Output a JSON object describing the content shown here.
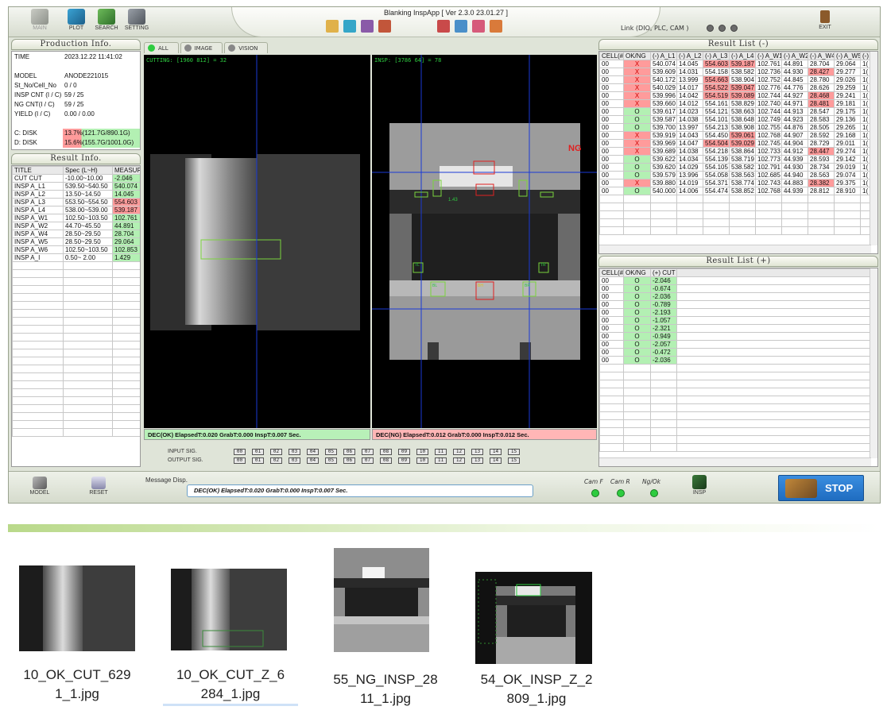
{
  "topbar": {
    "main_label": "MAIN",
    "plot_label": "PLOT",
    "search_label": "SEARCH",
    "setting_label": "SETTING",
    "title": "Blanking InspApp  [ Ver 2.3.0  23.01.27 ]",
    "link_label": "Link (DIO, PLC, CAM )",
    "exit_label": "EXIT"
  },
  "production": {
    "header": "Production Info.",
    "rows": [
      {
        "k": "TIME",
        "v": "2023.12.22  11:41:02"
      },
      {
        "k": "",
        "v": ""
      },
      {
        "k": "MODEL",
        "v": "ANODE221015"
      },
      {
        "k": "St_No/Cell_No",
        "v": "0 / 0"
      },
      {
        "k": "INSP CNT (I / C)",
        "v": "59 / 25"
      },
      {
        "k": "NG CNT(I / C)",
        "v": "59 / 25"
      },
      {
        "k": "YIELD (I / C)",
        "v": "0.00 /  0.00"
      },
      {
        "k": "",
        "v": ""
      },
      {
        "k": "C: DISK",
        "v": "13.7%(121.7G/890.1G)"
      },
      {
        "k": "D: DISK",
        "v": "15.6%(155.7G/1001.0G)"
      }
    ]
  },
  "result_info": {
    "header": "Result Info.",
    "columns": [
      "TITLE",
      "Spec (L~H)",
      "MEASUR"
    ],
    "rows": [
      {
        "title": "CUT CUT",
        "spec": "-10.00~10.00",
        "meas": "-2.046",
        "status": "ok"
      },
      {
        "title": "INSP A_L1",
        "spec": "539.50~540.50",
        "meas": "540.074",
        "status": "ok"
      },
      {
        "title": "INSP A_L2",
        "spec": "13.50~14.50",
        "meas": "14.045",
        "status": "ok"
      },
      {
        "title": "INSP A_L3",
        "spec": "553.50~554.50",
        "meas": "554.603",
        "status": "ng"
      },
      {
        "title": "INSP A_L4",
        "spec": "538.00~539.00",
        "meas": "539.187",
        "status": "ng"
      },
      {
        "title": "INSP A_W1",
        "spec": "102.50~103.50",
        "meas": "102.761",
        "status": "ok"
      },
      {
        "title": "INSP A_W2",
        "spec": "44.70~45.50",
        "meas": "44.891",
        "status": "ok"
      },
      {
        "title": "INSP A_W4",
        "spec": "28.50~29.50",
        "meas": "28.704",
        "status": "ok"
      },
      {
        "title": "INSP A_W5",
        "spec": "28.50~29.50",
        "meas": "29.064",
        "status": "ok"
      },
      {
        "title": "INSP A_W6",
        "spec": "102.50~103.50",
        "meas": "102.853",
        "status": "ok"
      },
      {
        "title": "INSP A_I",
        "spec": "0.50~ 2.00",
        "meas": "1.429",
        "status": "ok"
      }
    ]
  },
  "view_tabs": [
    "ALL",
    "IMAGE",
    "VISION"
  ],
  "cam_left": {
    "label": "CUTTING:  [1960  812] = 32",
    "status": "DEC(OK)  ElapsedT:0.020  GrabT:0.000 InspT:0.007 Sec."
  },
  "cam_right": {
    "label": "INSP:      [3786  64] = 78",
    "ng": "NG",
    "status": "DEC(NG)  ElapsedT:0.012  GrabT:0.000 InspT:0.012 Sec.",
    "roi_tags": [
      "TL",
      "TR",
      "BL",
      "BH",
      "BR",
      "1.43"
    ]
  },
  "signals": {
    "input_label": "INPUT   SIG.",
    "output_label": "OUTPUT SIG.",
    "bits": [
      "00",
      "01",
      "02",
      "03",
      "04",
      "05",
      "06",
      "07",
      "08",
      "09",
      "10",
      "11",
      "12",
      "13",
      "14",
      "15"
    ]
  },
  "result_minus": {
    "header": "Result List (-)",
    "columns": [
      "CELL(#)",
      "OK/NG",
      "(-) A_L1",
      "(-) A_L2",
      "(-) A_L3",
      "(-) A_L4",
      "(-) A_W1",
      "(-) A_W2",
      "(-) A_W4",
      "(-) A_W5",
      "(-)"
    ],
    "rows": [
      {
        "cell": "00",
        "ok": "X",
        "v": [
          "540.074",
          "14.045",
          "554.603",
          "539.187",
          "102.761",
          "44.891",
          "28.704",
          "29.064",
          "1("
        ],
        "flags": [
          0,
          0,
          1,
          1,
          0,
          0,
          0,
          0,
          0
        ]
      },
      {
        "cell": "00",
        "ok": "X",
        "v": [
          "539.609",
          "14.031",
          "554.158",
          "538.582",
          "102.736",
          "44.930",
          "28.427",
          "29.277",
          "1("
        ],
        "flags": [
          0,
          0,
          0,
          0,
          0,
          0,
          1,
          0,
          0
        ]
      },
      {
        "cell": "00",
        "ok": "X",
        "v": [
          "540.172",
          "13.999",
          "554.663",
          "538.904",
          "102.752",
          "44.845",
          "28.780",
          "29.026",
          "1("
        ],
        "flags": [
          0,
          0,
          1,
          0,
          0,
          0,
          0,
          0,
          0
        ]
      },
      {
        "cell": "00",
        "ok": "X",
        "v": [
          "540.029",
          "14.017",
          "554.522",
          "539.047",
          "102.776",
          "44.776",
          "28.626",
          "29.259",
          "1("
        ],
        "flags": [
          0,
          0,
          1,
          1,
          0,
          0,
          0,
          0,
          0
        ]
      },
      {
        "cell": "00",
        "ok": "X",
        "v": [
          "539.996",
          "14.042",
          "554.519",
          "539.089",
          "102.744",
          "44.927",
          "28.468",
          "29.241",
          "1("
        ],
        "flags": [
          0,
          0,
          1,
          1,
          0,
          0,
          1,
          0,
          0
        ]
      },
      {
        "cell": "00",
        "ok": "X",
        "v": [
          "539.660",
          "14.012",
          "554.161",
          "538.829",
          "102.740",
          "44.971",
          "28.481",
          "29.181",
          "1("
        ],
        "flags": [
          0,
          0,
          0,
          0,
          0,
          0,
          1,
          0,
          0
        ]
      },
      {
        "cell": "00",
        "ok": "O",
        "v": [
          "539.617",
          "14.023",
          "554.121",
          "538.663",
          "102.744",
          "44.913",
          "28.547",
          "29.175",
          "1("
        ],
        "flags": [
          0,
          0,
          0,
          0,
          0,
          0,
          0,
          0,
          0
        ]
      },
      {
        "cell": "00",
        "ok": "O",
        "v": [
          "539.587",
          "14.038",
          "554.101",
          "538.648",
          "102.749",
          "44.923",
          "28.583",
          "29.136",
          "1("
        ],
        "flags": [
          0,
          0,
          0,
          0,
          0,
          0,
          0,
          0,
          0
        ]
      },
      {
        "cell": "00",
        "ok": "O",
        "v": [
          "539.700",
          "13.997",
          "554.213",
          "538.908",
          "102.755",
          "44.876",
          "28.505",
          "29.265",
          "1("
        ],
        "flags": [
          0,
          0,
          0,
          0,
          0,
          0,
          0,
          0,
          0
        ]
      },
      {
        "cell": "00",
        "ok": "X",
        "v": [
          "539.919",
          "14.043",
          "554.450",
          "539.061",
          "102.768",
          "44.907",
          "28.592",
          "29.168",
          "1("
        ],
        "flags": [
          0,
          0,
          0,
          1,
          0,
          0,
          0,
          0,
          0
        ]
      },
      {
        "cell": "00",
        "ok": "X",
        "v": [
          "539.969",
          "14.047",
          "554.504",
          "539.029",
          "102.745",
          "44.904",
          "28.729",
          "29.011",
          "1("
        ],
        "flags": [
          0,
          0,
          1,
          1,
          0,
          0,
          0,
          0,
          0
        ]
      },
      {
        "cell": "00",
        "ok": "X",
        "v": [
          "539.689",
          "14.038",
          "554.218",
          "538.864",
          "102.733",
          "44.912",
          "28.447",
          "29.274",
          "1("
        ],
        "flags": [
          0,
          0,
          0,
          0,
          0,
          0,
          1,
          0,
          0
        ]
      },
      {
        "cell": "00",
        "ok": "O",
        "v": [
          "539.622",
          "14.034",
          "554.139",
          "538.719",
          "102.773",
          "44.939",
          "28.593",
          "29.142",
          "1("
        ],
        "flags": [
          0,
          0,
          0,
          0,
          0,
          0,
          0,
          0,
          0
        ]
      },
      {
        "cell": "00",
        "ok": "O",
        "v": [
          "539.620",
          "14.029",
          "554.105",
          "538.582",
          "102.791",
          "44.930",
          "28.734",
          "29.019",
          "1("
        ],
        "flags": [
          0,
          0,
          0,
          0,
          0,
          0,
          0,
          0,
          0
        ]
      },
      {
        "cell": "00",
        "ok": "O",
        "v": [
          "539.579",
          "13.996",
          "554.058",
          "538.563",
          "102.685",
          "44.940",
          "28.563",
          "29.074",
          "1("
        ],
        "flags": [
          0,
          0,
          0,
          0,
          0,
          0,
          0,
          0,
          0
        ]
      },
      {
        "cell": "00",
        "ok": "X",
        "v": [
          "539.880",
          "14.019",
          "554.371",
          "538.774",
          "102.743",
          "44.883",
          "28.382",
          "29.375",
          "1("
        ],
        "flags": [
          0,
          0,
          0,
          0,
          0,
          0,
          1,
          0,
          0
        ]
      },
      {
        "cell": "00",
        "ok": "O",
        "v": [
          "540.000",
          "14.006",
          "554.474",
          "538.852",
          "102.768",
          "44.939",
          "28.812",
          "28.910",
          "1("
        ],
        "flags": [
          0,
          0,
          0,
          0,
          0,
          0,
          0,
          0,
          0
        ]
      }
    ]
  },
  "result_plus": {
    "header": "Result List (+)",
    "columns": [
      "CELL(#)",
      "OK/NG",
      "(+) CUT"
    ],
    "rows": [
      {
        "cell": "00",
        "ok": "O",
        "cut": "-2.046"
      },
      {
        "cell": "00",
        "ok": "O",
        "cut": "-0.674"
      },
      {
        "cell": "00",
        "ok": "O",
        "cut": "-2.036"
      },
      {
        "cell": "00",
        "ok": "O",
        "cut": "-0.789"
      },
      {
        "cell": "00",
        "ok": "O",
        "cut": "-2.193"
      },
      {
        "cell": "00",
        "ok": "O",
        "cut": "-1.057"
      },
      {
        "cell": "00",
        "ok": "O",
        "cut": "-2.321"
      },
      {
        "cell": "00",
        "ok": "O",
        "cut": "-0.949"
      },
      {
        "cell": "00",
        "ok": "O",
        "cut": "-2.057"
      },
      {
        "cell": "00",
        "ok": "O",
        "cut": "-0.472"
      },
      {
        "cell": "00",
        "ok": "O",
        "cut": "-2.036"
      }
    ]
  },
  "bottombar": {
    "model_label": "MODEL",
    "reset_label": "RESET",
    "msg_label": "Message Disp.",
    "msg": "DEC(OK)  ElapsedT:0.020  GrabT:0.000 InspT:0.007 Sec.",
    "cam_f": "Cam F",
    "cam_r": "Cam R",
    "ng_ok": "Ng/Ok",
    "insp_label": "INSP",
    "stop_label": "STOP"
  },
  "files": [
    {
      "line1": "10_OK_CUT_629",
      "line2": "1_1.jpg"
    },
    {
      "line1": "10_OK_CUT_Z_6",
      "line2": "284_1.jpg"
    },
    {
      "line1": "55_NG_INSP_28",
      "line2": "11_1.jpg"
    },
    {
      "line1": "54_OK_INSP_Z_2",
      "line2": "809_1.jpg"
    }
  ],
  "colors": {
    "ng_red": "#ff9b9b",
    "ok_green": "#b3f0b3",
    "stop_blue": "#1f6cc0",
    "roi_green": "#2ecc40"
  }
}
